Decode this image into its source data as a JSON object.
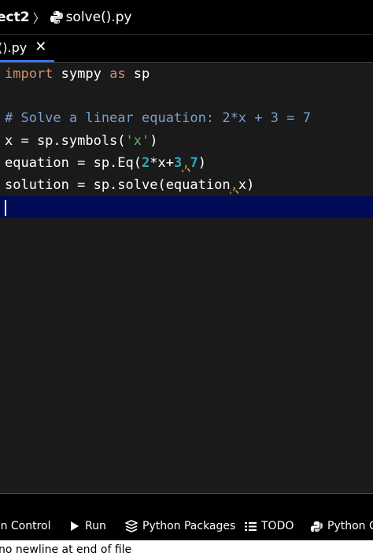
{
  "breadcrumb": {
    "project": "ect2",
    "separator": "〉",
    "file": "solve().py"
  },
  "tabs": [
    {
      "label": "().py",
      "close": "✕",
      "active": true
    }
  ],
  "editor": {
    "lines": [
      [
        {
          "t": "import",
          "c": "kw"
        },
        {
          "t": " sympy ",
          "c": "plain"
        },
        {
          "t": "as",
          "c": "kw"
        },
        {
          "t": " sp",
          "c": "plain"
        }
      ],
      [],
      [
        {
          "t": "# Solve a linear equation: 2*x + 3 = 7",
          "c": "cm"
        }
      ],
      [
        {
          "t": "x = sp.symbols(",
          "c": "plain"
        },
        {
          "t": "'x'",
          "c": "str"
        },
        {
          "t": ")",
          "c": "plain"
        }
      ],
      [
        {
          "t": "equation = sp.Eq(",
          "c": "plain"
        },
        {
          "t": "2",
          "c": "num"
        },
        {
          "t": "*x+",
          "c": "plain"
        },
        {
          "t": "3",
          "c": "num"
        },
        {
          "t": ",",
          "c": "warn"
        },
        {
          "t": "7",
          "c": "num"
        },
        {
          "t": ")",
          "c": "plain"
        }
      ],
      [
        {
          "t": "solution = sp.solve(equation",
          "c": "plain"
        },
        {
          "t": ",",
          "c": "warn"
        },
        {
          "t": "x)",
          "c": "plain"
        }
      ]
    ]
  },
  "toolstrip": {
    "items": [
      {
        "label": "on Control",
        "icon": "version-control-icon"
      },
      {
        "label": "Run",
        "icon": "run-icon"
      },
      {
        "label": "Python Packages",
        "icon": "packages-icon"
      },
      {
        "label": "TODO",
        "icon": "todo-icon"
      },
      {
        "label": "Python Co",
        "icon": "python-console-icon"
      }
    ]
  },
  "statusbar": {
    "message": "no newline at end of file"
  },
  "colors": {
    "keyword": "#cf8e6d",
    "comment": "#7a9fc8",
    "string": "#6aab73",
    "number": "#2aacb8",
    "current_line": "#000a55",
    "tab_underline": "#3574f0"
  }
}
